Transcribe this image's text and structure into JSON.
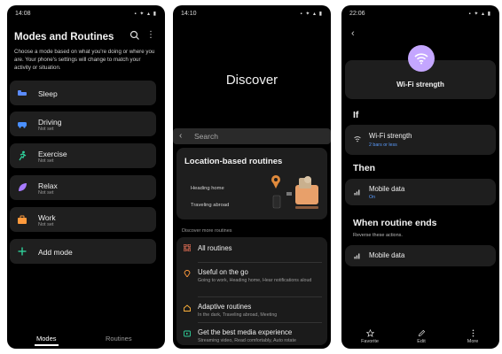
{
  "panel1": {
    "time": "14:08",
    "title": "Modes and Routines",
    "description": "Choose a mode based on what you're doing or where you are. Your phone's settings will change to match your activity or situation.",
    "modes": [
      {
        "label": "Sleep",
        "sub": "",
        "icon": "sleep-icon",
        "color": "#5b8cff"
      },
      {
        "label": "Driving",
        "sub": "Not set",
        "icon": "car-icon",
        "color": "#4a90ff"
      },
      {
        "label": "Exercise",
        "sub": "Not set",
        "icon": "running-icon",
        "color": "#2fcf9a"
      },
      {
        "label": "Relax",
        "sub": "Not set",
        "icon": "leaf-icon",
        "color": "#a77bff"
      },
      {
        "label": "Work",
        "sub": "Not set",
        "icon": "briefcase-icon",
        "color": "#ff9a3c"
      },
      {
        "label": "Add mode",
        "sub": "",
        "icon": "plus-icon",
        "color": "#2fcf9a"
      }
    ],
    "tabs": {
      "modes": "Modes",
      "routines": "Routines"
    }
  },
  "panel2": {
    "time": "14:10",
    "title": "Discover",
    "search_placeholder": "Search",
    "card": {
      "title": "Location-based routines",
      "line1": "Heading home",
      "line2": "Traveling abroad"
    },
    "section_label": "Discover more routines",
    "items": [
      {
        "title": "All routines",
        "sub": "",
        "icon": "grid-icon",
        "color": "#ff7a5c"
      },
      {
        "title": "Useful on the go",
        "sub": "Going to work, Heading home, Hear notifications aloud",
        "icon": "location-pin-icon",
        "color": "#ff9a3c"
      },
      {
        "title": "Adaptive routines",
        "sub": "In the dark, Traveling abroad, Meeting",
        "icon": "home-icon",
        "color": "#ffb23c"
      },
      {
        "title": "Get the best media experience",
        "sub": "Streaming video, Read comfortably, Auto rotate",
        "icon": "media-icon",
        "color": "#2fcf9a"
      }
    ]
  },
  "panel3": {
    "time": "22:06",
    "hero_label": "Wi-Fi strength",
    "if_label": "If",
    "if_item": {
      "title": "Wi-Fi strength",
      "sub": "2 bars or less"
    },
    "then_label": "Then",
    "then_item": {
      "title": "Mobile data",
      "sub": "On"
    },
    "ends_label": "When routine ends",
    "ends_note": "Reverse these actions.",
    "ends_item": {
      "title": "Mobile data"
    },
    "bottom": {
      "favorite": "Favorite",
      "edit": "Edit",
      "more": "More"
    },
    "accent": "#5b9dff",
    "hero_color": "#c4a6ff"
  }
}
